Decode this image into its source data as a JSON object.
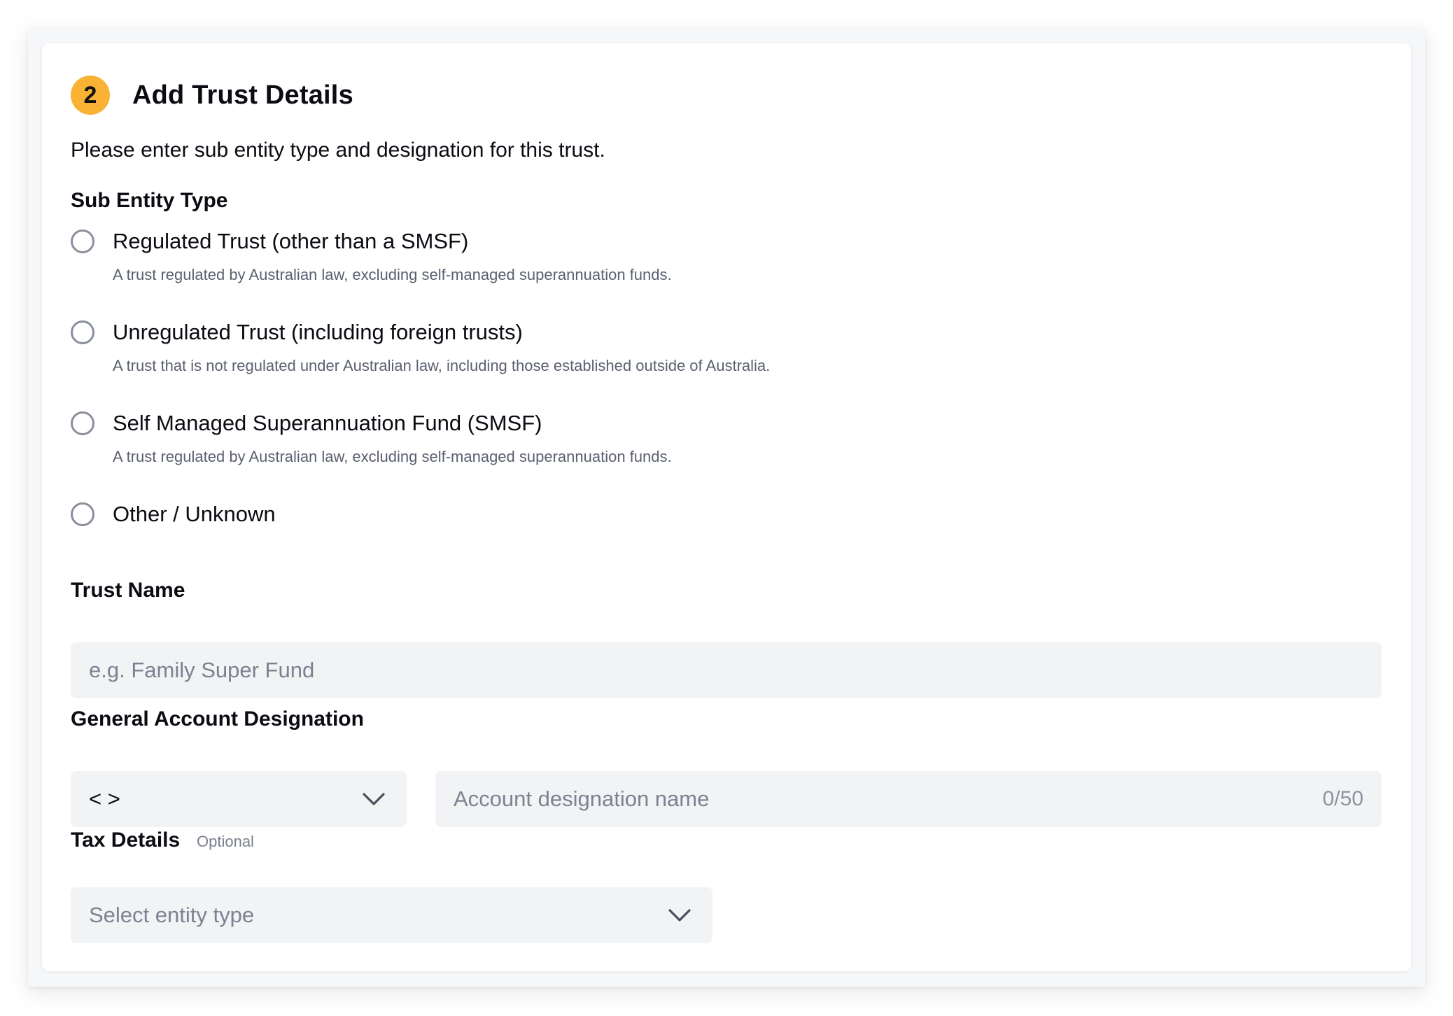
{
  "step": {
    "number": "2",
    "title": "Add Trust Details",
    "description": "Please enter sub entity type and designation for this trust."
  },
  "sub_entity": {
    "label": "Sub Entity Type",
    "options": [
      {
        "label": "Regulated Trust (other than a SMSF)",
        "description": "A trust regulated by Australian law, excluding self-managed superannuation funds.",
        "selected": false
      },
      {
        "label": "Unregulated Trust (including foreign trusts)",
        "description": "A trust that is not regulated under Australian law, including those established outside of Australia.",
        "selected": false
      },
      {
        "label": "Self Managed Superannuation Fund (SMSF)",
        "description": "A trust regulated by Australian law, excluding self-managed superannuation funds.",
        "selected": false
      },
      {
        "label": "Other / Unknown",
        "selected": false
      }
    ]
  },
  "trust_name": {
    "label": "Trust Name",
    "placeholder": "e.g. Family Super Fund",
    "value": ""
  },
  "designation": {
    "label": "General Account Designation",
    "select_value": "< >",
    "name_placeholder": "Account designation name",
    "counter": "0/50"
  },
  "tax": {
    "label": "Tax Details",
    "optional_label": "Optional",
    "placeholder": "Select entity type"
  },
  "colors": {
    "accent": "#f9b233",
    "field_bg": "#f2f3f5",
    "radio_border": "#8a8f9c",
    "muted_text": "#5b6070"
  },
  "icons": [
    "chevron-down-icon"
  ]
}
